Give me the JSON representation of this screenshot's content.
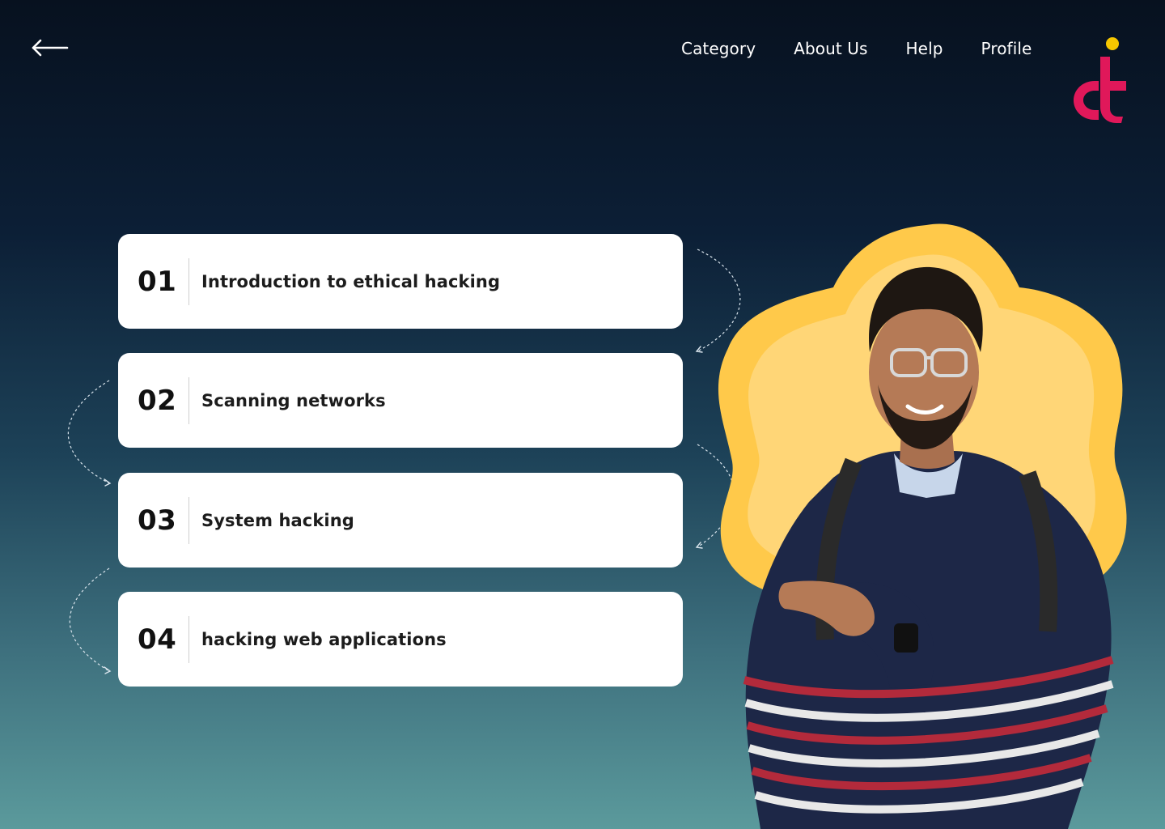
{
  "header": {
    "back_icon": "arrow-left-icon",
    "nav": [
      {
        "label": "Category"
      },
      {
        "label": "About Us"
      },
      {
        "label": "Help"
      },
      {
        "label": "Profile"
      }
    ],
    "logo_icon": "brand-logo-icon"
  },
  "modules": [
    {
      "number": "01",
      "title": "Introduction to ethical hacking"
    },
    {
      "number": "02",
      "title": "Scanning networks"
    },
    {
      "number": "03",
      "title": "System hacking"
    },
    {
      "number": "04",
      "title": "hacking web applications"
    }
  ],
  "colors": {
    "background_top": "#07111f",
    "background_bottom": "#5b9a9c",
    "card": "#ffffff",
    "blob_outer": "#ffc94a",
    "blob_inner": "#ffd677",
    "logo_magenta": "#e0185a",
    "logo_yellow": "#f6c700"
  }
}
